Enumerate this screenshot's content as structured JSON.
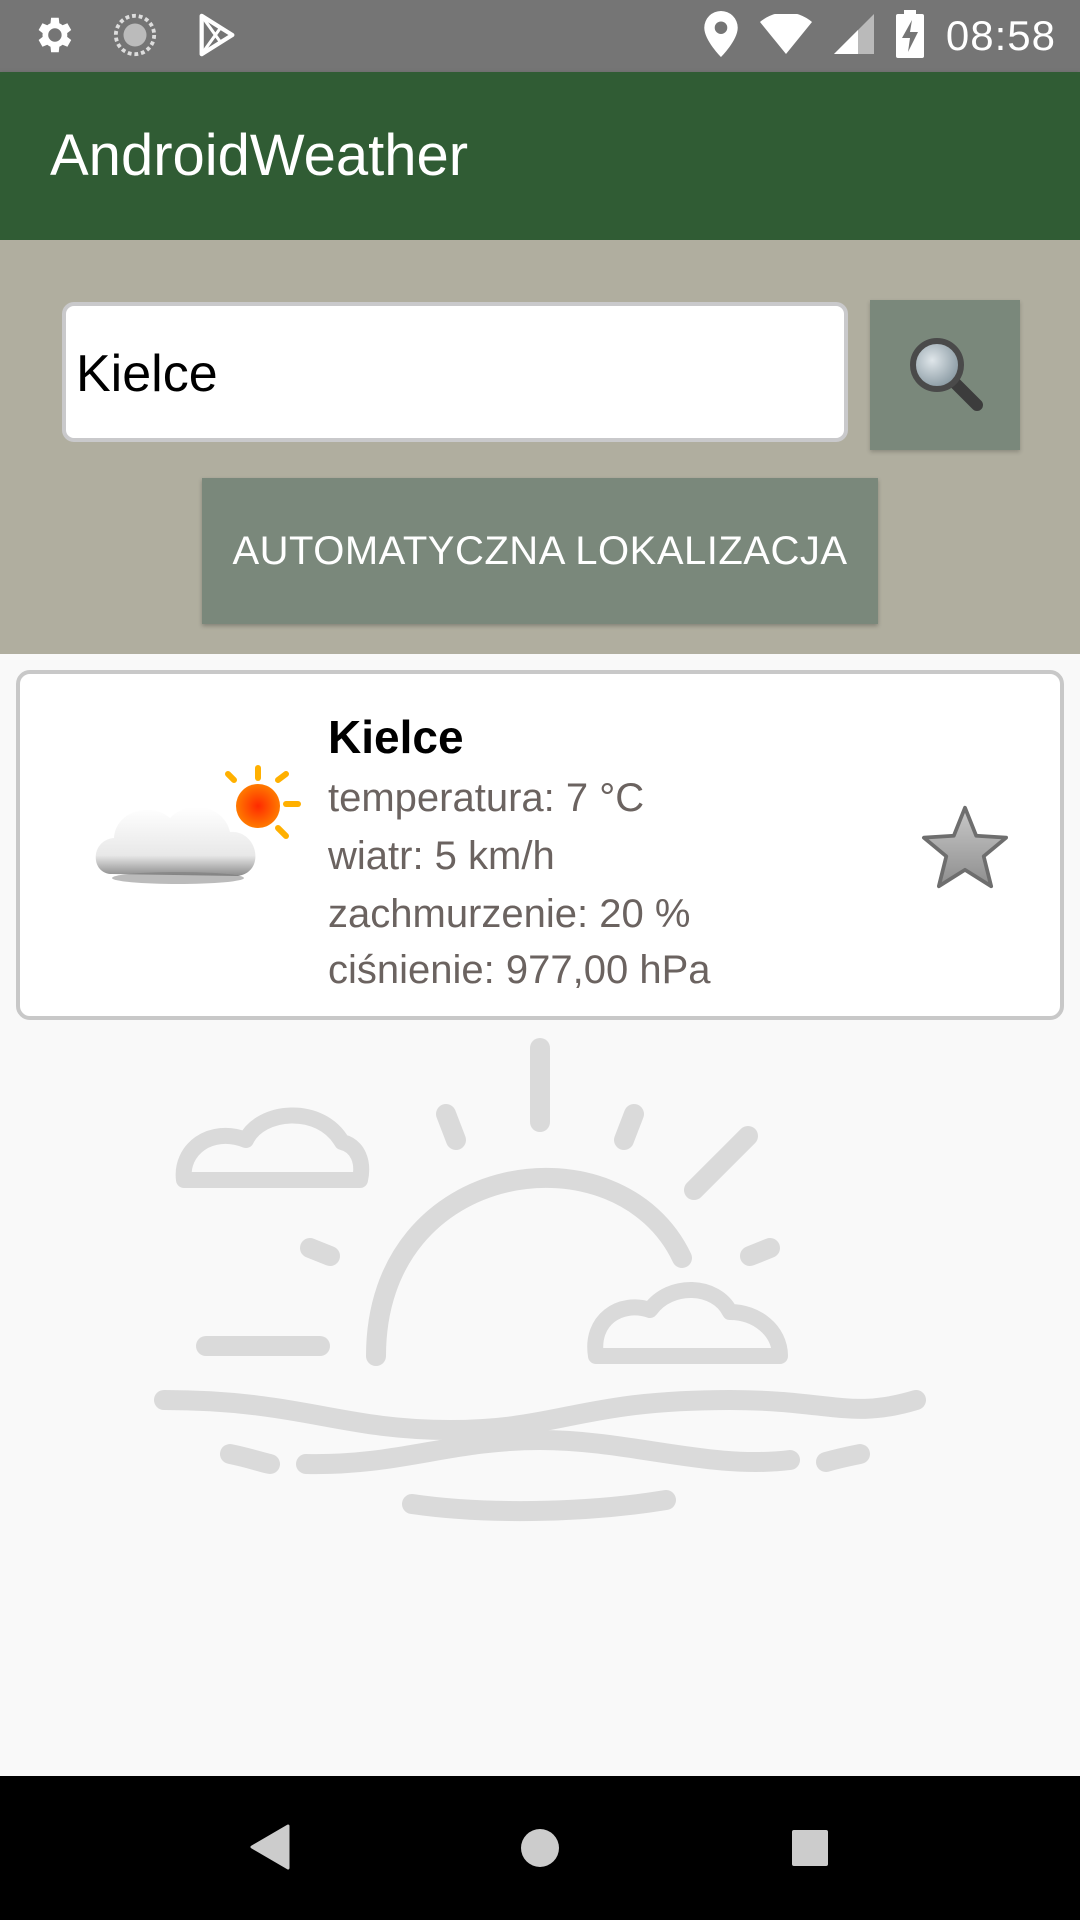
{
  "status_bar": {
    "time": "08:58",
    "left_icons": [
      "gear-icon",
      "sync-icon",
      "play-store-icon"
    ],
    "right_icons": [
      "location-icon",
      "wifi-icon",
      "signal-icon",
      "battery-charging-icon"
    ]
  },
  "app_bar": {
    "title": "AndroidWeather"
  },
  "search": {
    "value": "Kielce",
    "button_icon": "search-icon",
    "auto_location_label": "AUTOMATYCZNA LOKALIZACJA"
  },
  "card": {
    "icon": "partly-cloudy-icon",
    "city": "Kielce",
    "temperature": "temperatura: 7 °C",
    "wind": "wiatr: 5 km/h",
    "clouds": "zachmurzenie: 20 %",
    "pressure": "ciśnienie: 977,00 hPa",
    "favorite_icon": "star-icon"
  },
  "background": {
    "icon": "sunset-illustration"
  },
  "nav_bar": {
    "buttons": [
      "back-icon",
      "home-icon",
      "recents-icon"
    ]
  },
  "colors": {
    "status_bar": "#757575",
    "app_bar": "#305c34",
    "panel": "#b0ae9f",
    "button": "#7a887b",
    "detail_text": "#6b6360"
  }
}
